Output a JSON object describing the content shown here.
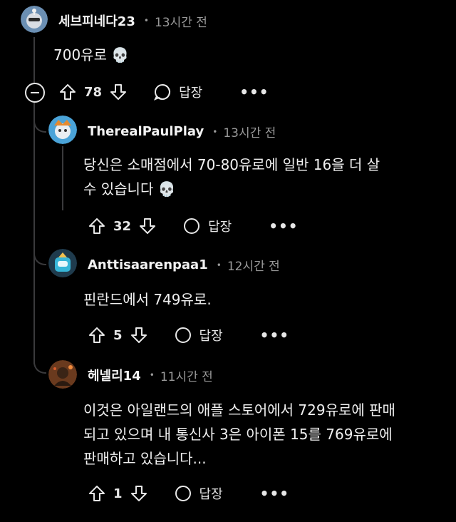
{
  "comments": [
    {
      "username": "세브피네다23",
      "time": "13시간 전",
      "text_lines": [
        "700유로 💀"
      ],
      "votes": "78",
      "reply_label": "답장",
      "more_label": "•••"
    },
    {
      "username": "TherealPaulPlay",
      "time": "13시간 전",
      "text_lines": [
        "당신은 소매점에서 70-80유로에 일반 16을 더 살",
        "수 있습니다 💀"
      ],
      "votes": "32",
      "reply_label": "답장",
      "more_label": "•••"
    },
    {
      "username": "Anttisaarenpaa1",
      "time": "12시간 전",
      "text_lines": [
        "핀란드에서 749유로."
      ],
      "votes": "5",
      "reply_label": "답장",
      "more_label": "•••"
    },
    {
      "username": "헤넬리14",
      "time": "11시간 전",
      "text_lines": [
        "이것은 아일랜드의 애플 스토어에서 729유로에 판매",
        "되고 있으며 내 통신사 3은 아이폰 15를 769유로에",
        "판매하고 있습니다..."
      ],
      "votes": "1",
      "reply_label": "답장",
      "more_label": "•••"
    }
  ],
  "dot_separator": "•",
  "icons": [
    "upvote-icon",
    "downvote-icon",
    "comment-bubble-icon",
    "collapse-icon"
  ]
}
